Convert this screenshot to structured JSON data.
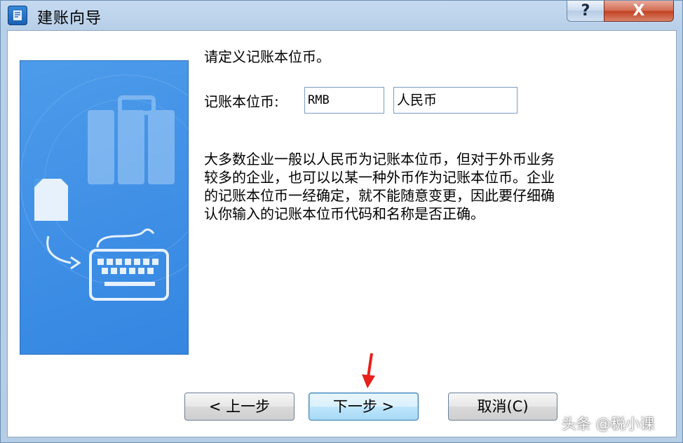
{
  "window": {
    "title": "建账向导",
    "help_label": "?",
    "close_label": "X"
  },
  "main": {
    "prompt": "请定义记账本位币。",
    "currency_label": "记账本位币:",
    "currency_code": "RMB",
    "currency_name": "人民币",
    "description": "大多数企业一般以人民币为记账本位币，但对于外币业务较多的企业，也可以以某一种外币作为记账本位币。企业的记账本位币一经确定，就不能随意变更，因此要仔细确认你输入的记账本位币代码和名称是否正确。"
  },
  "buttons": {
    "prev": "< 上一步",
    "next": "下一步 >",
    "cancel": "取消(C)"
  },
  "watermark": "头条 @税小课",
  "colors": {
    "panel_blue": "#3f8fe6",
    "annotation_arrow": "#e8201a"
  }
}
